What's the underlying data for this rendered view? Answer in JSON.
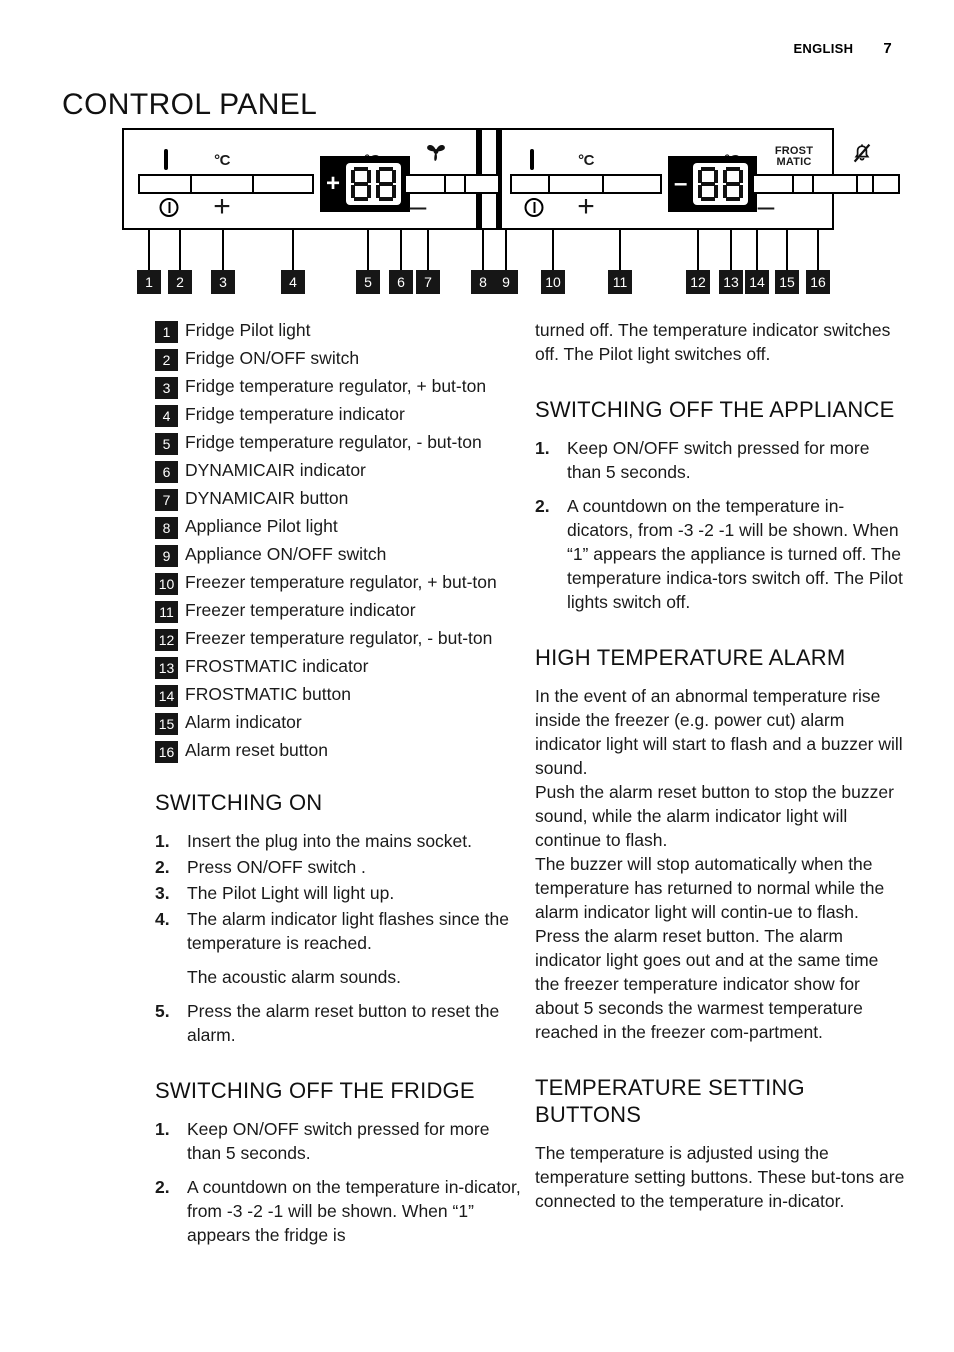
{
  "header": {
    "language": "ENGLISH",
    "page_number": "7"
  },
  "title": "CONTROL PANEL",
  "panel": {
    "fridge_icon": "fridge-icon",
    "freezer_icon": "fridge-freezer-icon",
    "celsius_label": "°C",
    "fan_icon": "dynamicair-fan-icon",
    "frostmatic_line1": "FROST",
    "frostmatic_line2": "MATIC",
    "alarm_icon": "alarm-bell-muted-icon",
    "power_icon": "power-on-off-icon",
    "plus_glyph": "+",
    "minus_glyph": "–",
    "fridge_display_sign": "+",
    "freezer_display_sign": "–",
    "display_value": "88",
    "callouts": [
      "1",
      "2",
      "3",
      "4",
      "5",
      "6",
      "7",
      "8",
      "9",
      "10",
      "11",
      "12",
      "13",
      "14",
      "15",
      "16"
    ]
  },
  "legend": [
    {
      "num": "1",
      "text": "Fridge Pilot light"
    },
    {
      "num": "2",
      "text": "Fridge ON/OFF switch"
    },
    {
      "num": "3",
      "text": "Fridge temperature regulator, + but-ton"
    },
    {
      "num": "4",
      "text": "Fridge temperature indicator"
    },
    {
      "num": "5",
      "text": "Fridge temperature regulator, - but-ton"
    },
    {
      "num": "6",
      "text": "DYNAMICAIR indicator"
    },
    {
      "num": "7",
      "text": "DYNAMICAIR button"
    },
    {
      "num": "8",
      "text": "Appliance Pilot light"
    },
    {
      "num": "9",
      "text": "Appliance ON/OFF switch"
    },
    {
      "num": "10",
      "text": "Freezer temperature regulator, + but-ton"
    },
    {
      "num": "11",
      "text": "Freezer temperature indicator"
    },
    {
      "num": "12",
      "text": "Freezer temperature regulator, - but-ton"
    },
    {
      "num": "13",
      "text": "FROSTMATIC indicator"
    },
    {
      "num": "14",
      "text": "FROSTMATIC button"
    },
    {
      "num": "15",
      "text": "Alarm indicator"
    },
    {
      "num": "16",
      "text": "Alarm reset button"
    }
  ],
  "switching_on": {
    "heading": "SWITCHING ON",
    "steps": [
      {
        "num": "1.",
        "text": "Insert the plug into the mains socket."
      },
      {
        "num": "2.",
        "text": "Press ON/OFF switch ."
      },
      {
        "num": "3.",
        "text": "The Pilot Light will light up."
      },
      {
        "num": "4.",
        "text": "The alarm indicator light flashes since the temperature is reached."
      },
      {
        "num": "5.",
        "text": "Press the alarm reset button to reset the alarm."
      }
    ],
    "sub_para": "The acoustic alarm sounds."
  },
  "switching_off_fridge": {
    "heading": "SWITCHING OFF THE FRIDGE",
    "steps": [
      {
        "num": "1.",
        "text": "Keep ON/OFF switch pressed for more than 5 seconds."
      },
      {
        "num": "2.",
        "text": "A countdown on the temperature in-dicator, from -3 -2 -1 will be shown. When “1” appears the fridge is"
      }
    ]
  },
  "continuation": {
    "text": "turned off. The temperature indicator switches off. The Pilot light switches off."
  },
  "switching_off_appliance": {
    "heading": "SWITCHING OFF THE APPLIANCE",
    "steps": [
      {
        "num": "1.",
        "text": "Keep ON/OFF switch pressed for more than 5 seconds."
      },
      {
        "num": "2.",
        "text": "A countdown on the temperature in-dicators, from -3 -2 -1 will be shown. When “1” appears the appliance is turned off. The temperature indica-tors switch off. The Pilot lights switch off."
      }
    ]
  },
  "high_temperature_alarm": {
    "heading": "HIGH TEMPERATURE ALARM",
    "paragraphs": [
      "In the event of an abnormal temperature rise inside the freezer (e.g. power cut) alarm indicator light will start to flash and a buzzer will sound.",
      "Push the alarm reset button to stop the buzzer sound, while the alarm indicator light will continue to flash.",
      "The buzzer will stop automatically when the temperature has returned to normal while the alarm indicator light will contin-ue to flash.",
      "Press the alarm reset button. The alarm indicator light goes out and at the same time the freezer temperature indicator show for about 5 seconds the warmest temperature reached in the freezer com-partment."
    ]
  },
  "temperature_setting_buttons": {
    "heading": "TEMPERATURE SETTING BUTTONS",
    "paragraphs": [
      "The temperature is adjusted using the temperature setting buttons. These but-tons are connected to the temperature in-dicator."
    ]
  }
}
